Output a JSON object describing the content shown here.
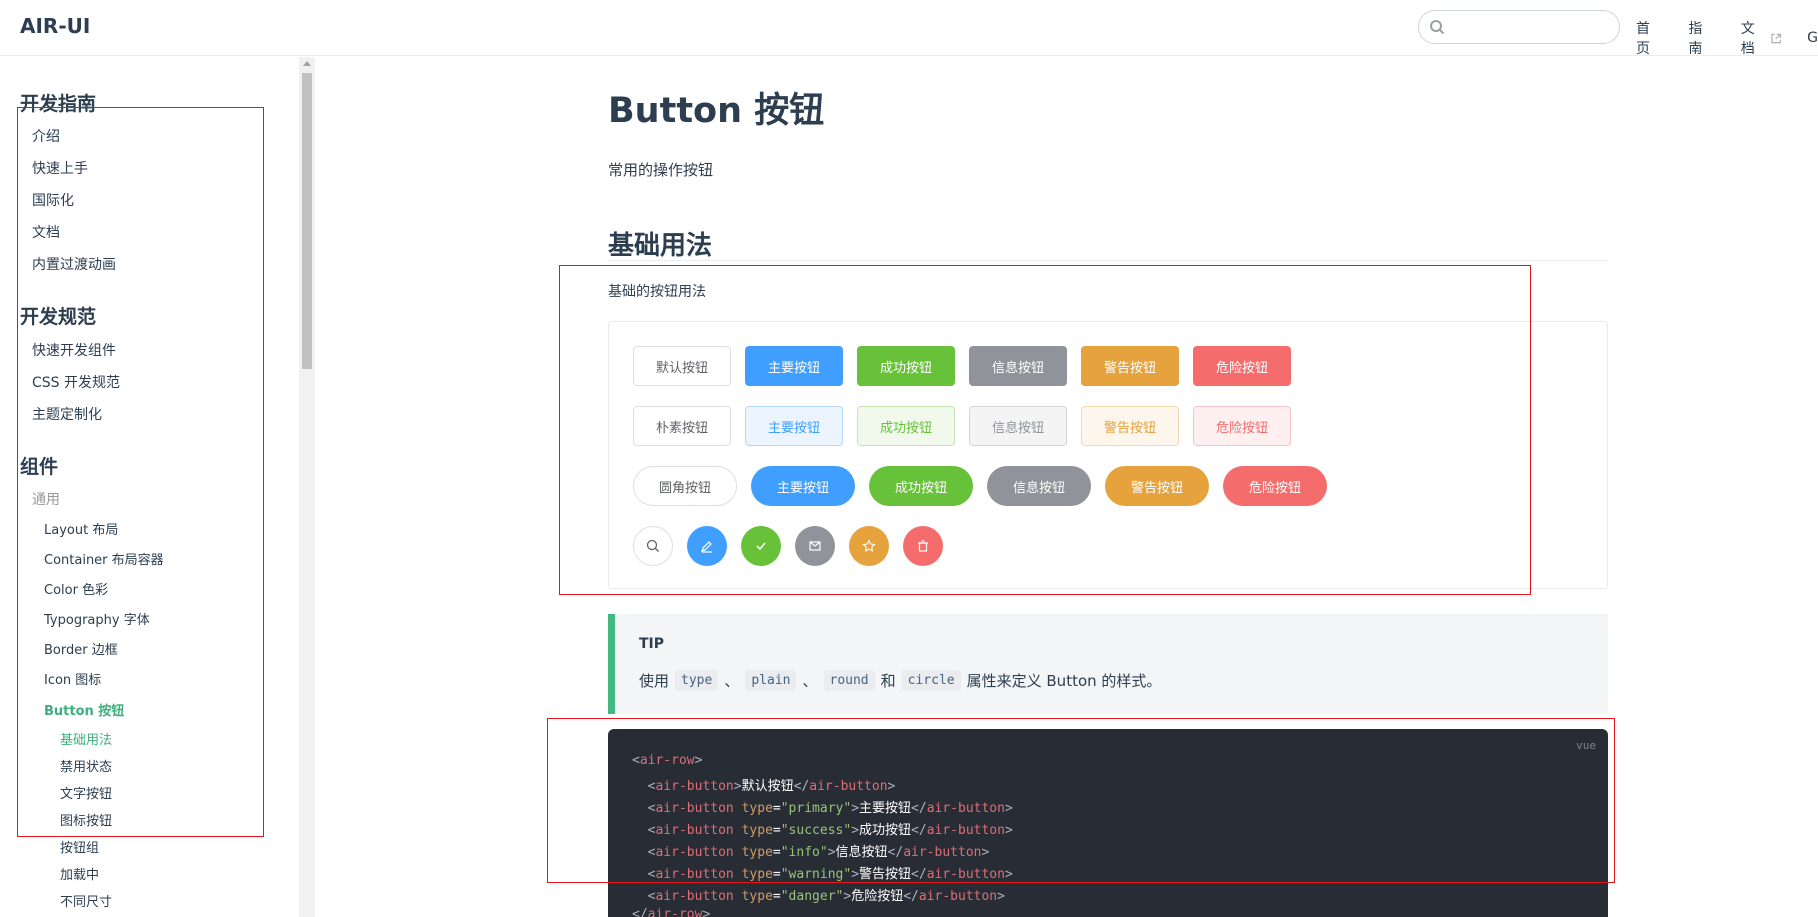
{
  "header": {
    "site_name": "AIR-UI",
    "search_placeholder": "",
    "nav": [
      "首页",
      "指南",
      "文档",
      "G"
    ]
  },
  "sidebar": {
    "groups": [
      "开发指南",
      "开发规范",
      "组件"
    ],
    "guide_items": [
      "介绍",
      "快速上手",
      "国际化",
      "文档",
      "内置过渡动画"
    ],
    "spec_items": [
      "快速开发组件",
      "CSS 开发规范",
      "主题定制化"
    ],
    "component_category": "通用",
    "component_items": [
      "Layout 布局",
      "Container 布局容器",
      "Color 色彩",
      "Typography 字体",
      "Border 边框",
      "Icon 图标"
    ],
    "active_item": "Button 按钮",
    "sub_items": [
      "基础用法",
      "禁用状态",
      "文字按钮",
      "图标按钮",
      "按钮组",
      "加载中",
      "不同尺寸"
    ]
  },
  "main": {
    "title": "Button 按钮",
    "description": "常用的操作按钮",
    "section_title": "基础用法",
    "section_description": "基础的按钮用法",
    "row1": [
      "默认按钮",
      "主要按钮",
      "成功按钮",
      "信息按钮",
      "警告按钮",
      "危险按钮"
    ],
    "row2": [
      "朴素按钮",
      "主要按钮",
      "成功按钮",
      "信息按钮",
      "警告按钮",
      "危险按钮"
    ],
    "row3": [
      "圆角按钮",
      "主要按钮",
      "成功按钮",
      "信息按钮",
      "警告按钮",
      "危险按钮"
    ],
    "row4_icons": [
      "search-icon",
      "edit-icon",
      "check-icon",
      "message-icon",
      "star-icon",
      "delete-icon"
    ],
    "tip": {
      "title": "TIP",
      "prefix": "使用",
      "code1": "type",
      "sep1": "、",
      "code2": "plain",
      "sep2": "、",
      "code3": "round",
      "and": "和",
      "code4": "circle",
      "suffix": "属性来定义 Button 的样式。"
    },
    "code": {
      "lang": "vue",
      "lines": [
        "<air-row>",
        "  <air-button>默认按钮</air-button>",
        "  <air-button type=\"primary\">主要按钮</air-button>",
        "  <air-button type=\"success\">成功按钮</air-button>",
        "  <air-button type=\"info\">信息按钮</air-button>",
        "  <air-button type=\"warning\">警告按钮</air-button>",
        "  <air-button type=\"danger\">危险按钮</air-button>",
        "</air-row>"
      ]
    }
  },
  "colors": {
    "primary": "#409eff",
    "success": "#67c23a",
    "info": "#909399",
    "warning": "#e6a23c",
    "danger": "#f56c6c",
    "accent": "#3eaf7c",
    "highlight_box": "#e3161e"
  }
}
